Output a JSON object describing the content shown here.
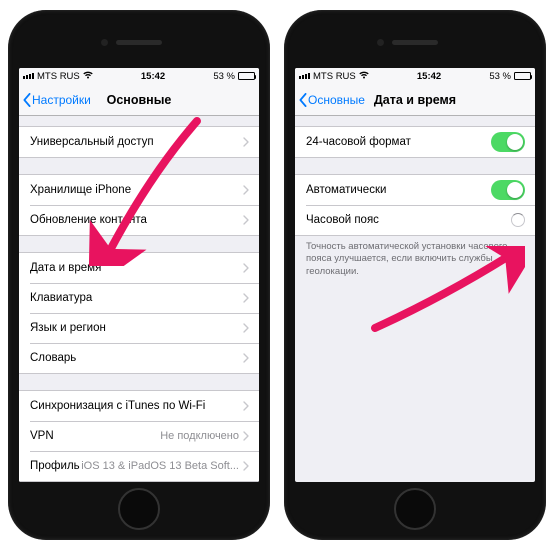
{
  "status": {
    "carrier": "MTS RUS",
    "time": "15:42",
    "battery": "53 %"
  },
  "left": {
    "back": "Настройки",
    "title": "Основные",
    "g1": [
      "Универсальный доступ"
    ],
    "g2": [
      "Хранилище iPhone",
      "Обновление контента"
    ],
    "g3": [
      "Дата и время",
      "Клавиатура",
      "Язык и регион",
      "Словарь"
    ],
    "g4": [
      {
        "label": "Синхронизация с iTunes по Wi-Fi"
      },
      {
        "label": "VPN",
        "value": "Не подключено"
      },
      {
        "label": "Профиль",
        "value": "iOS 13 & iPadOS 13 Beta Soft..."
      }
    ]
  },
  "right": {
    "back": "Основные",
    "title": "Дата и время",
    "r1": "24-часовой формат",
    "r2": "Автоматически",
    "r3": "Часовой пояс",
    "footer": "Точность автоматической установки часового пояса улучшается, если включить службы геолокации."
  }
}
